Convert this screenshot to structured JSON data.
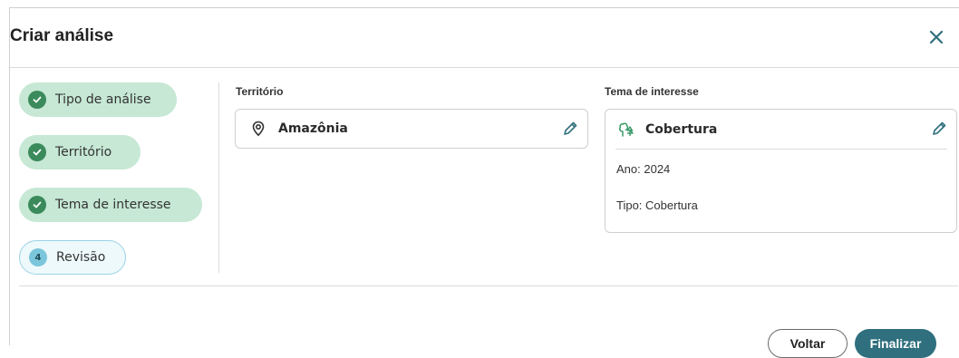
{
  "dialog": {
    "title": "Criar análise",
    "close_icon": "close-icon"
  },
  "steps": [
    {
      "label": "Tipo de análise",
      "state": "done",
      "icon": "check-icon"
    },
    {
      "label": "Território",
      "state": "done",
      "icon": "check-icon"
    },
    {
      "label": "Tema de interesse",
      "state": "done",
      "icon": "check-icon"
    },
    {
      "label": "Revisão",
      "state": "current",
      "number": "4"
    }
  ],
  "territory": {
    "section_label": "Território",
    "value": "Amazônia",
    "icon": "location-pin-icon",
    "edit_icon": "pencil-icon"
  },
  "theme": {
    "section_label": "Tema de interesse",
    "value": "Cobertura",
    "icon": "trees-icon",
    "edit_icon": "pencil-icon",
    "details": [
      "Ano: 2024",
      "Tipo: Cobertura"
    ]
  },
  "footer": {
    "back_label": "Voltar",
    "finish_label": "Finalizar"
  },
  "colors": {
    "step_done_bg": "#c6e8d4",
    "step_done_badge": "#3b8a5c",
    "step_current_bg": "#eef9fc",
    "step_current_border": "#9ad3e4",
    "primary_button": "#2f6f7e",
    "icon_accent": "#2f6f7e",
    "tree_icon": "#3b9a6a"
  }
}
